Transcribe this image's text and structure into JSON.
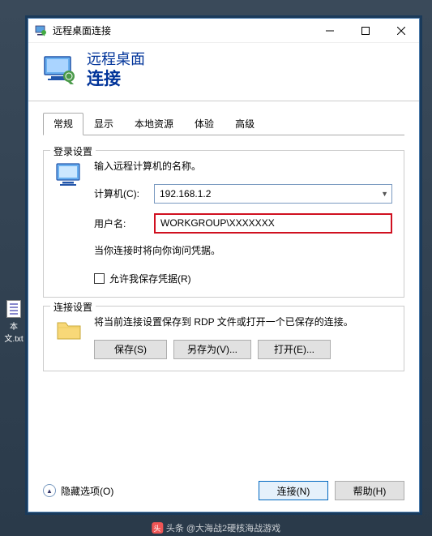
{
  "window": {
    "title": "远程桌面连接",
    "header_line1": "远程桌面",
    "header_line2": "连接"
  },
  "tabs": [
    "常规",
    "显示",
    "本地资源",
    "体验",
    "高级"
  ],
  "login_group": {
    "legend": "登录设置",
    "prompt": "输入远程计算机的名称。",
    "computer_label": "计算机(C):",
    "computer_value": "192.168.1.2",
    "username_label": "用户名:",
    "username_value": "WORKGROUP\\XXXXXXX",
    "hint": "当你连接时将向你询问凭据。",
    "checkbox_label": "允许我保存凭据(R)"
  },
  "conn_group": {
    "legend": "连接设置",
    "text": "将当前连接设置保存到 RDP 文件或打开一个已保存的连接。",
    "save_btn": "保存(S)",
    "saveas_btn": "另存为(V)...",
    "open_btn": "打开(E)..."
  },
  "footer": {
    "hide_opts": "隐藏选项(O)",
    "connect": "连接(N)",
    "help": "帮助(H)"
  },
  "desktop": {
    "file_label": "本文.txt"
  },
  "watermark": "头条 @大海战2硬核海战游戏"
}
